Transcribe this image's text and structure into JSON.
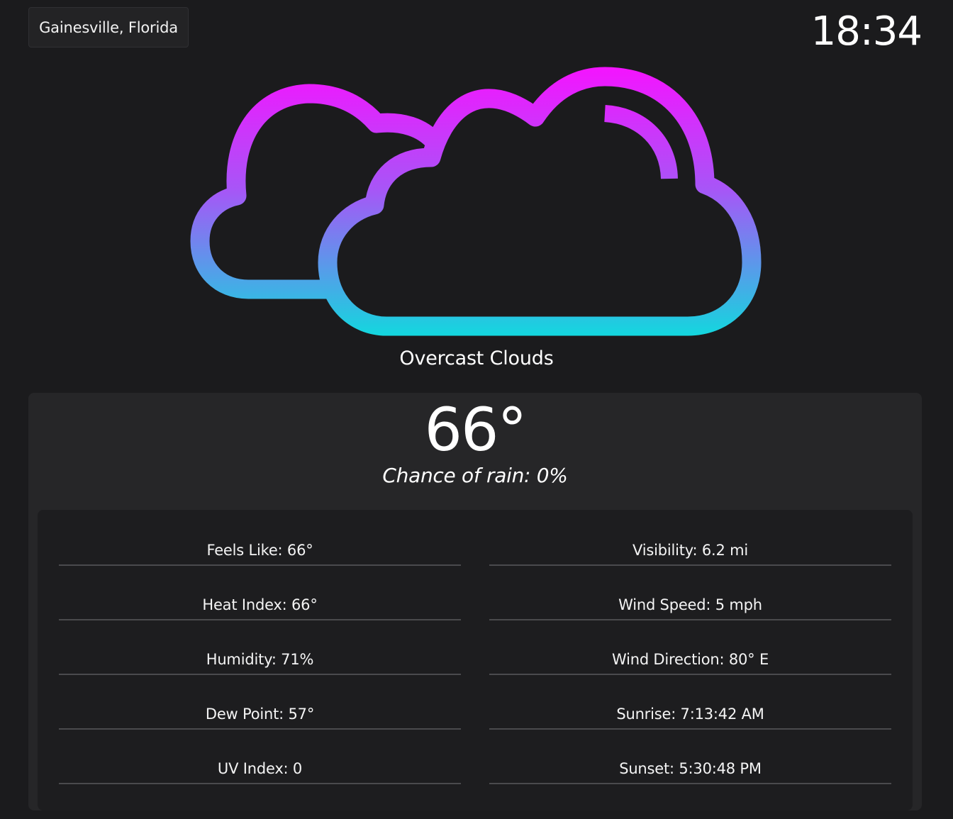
{
  "header": {
    "location": "Gainesville, Florida",
    "time": "18:34"
  },
  "icon": {
    "name": "overcast-clouds-icon",
    "gradient_top": "#f012ff",
    "gradient_bottom": "#12d6e0"
  },
  "condition": "Overcast Clouds",
  "current": {
    "temperature": "66°",
    "rain_chance": "Chance of rain: 0%"
  },
  "details": {
    "left": [
      "Feels Like: 66°",
      "Heat Index: 66°",
      "Humidity: 71%",
      "Dew Point: 57°",
      "UV Index: 0"
    ],
    "right": [
      "Visibility: 6.2 mi",
      "Wind Speed: 5 mph",
      "Wind Direction: 80° E",
      "Sunrise: 7:13:42 AM",
      "Sunset: 5:30:48 PM"
    ]
  },
  "colors": {
    "background": "#1b1b1d",
    "card": "#262628",
    "details_panel": "#1d1d1f",
    "divider": "#4a4a4d"
  }
}
